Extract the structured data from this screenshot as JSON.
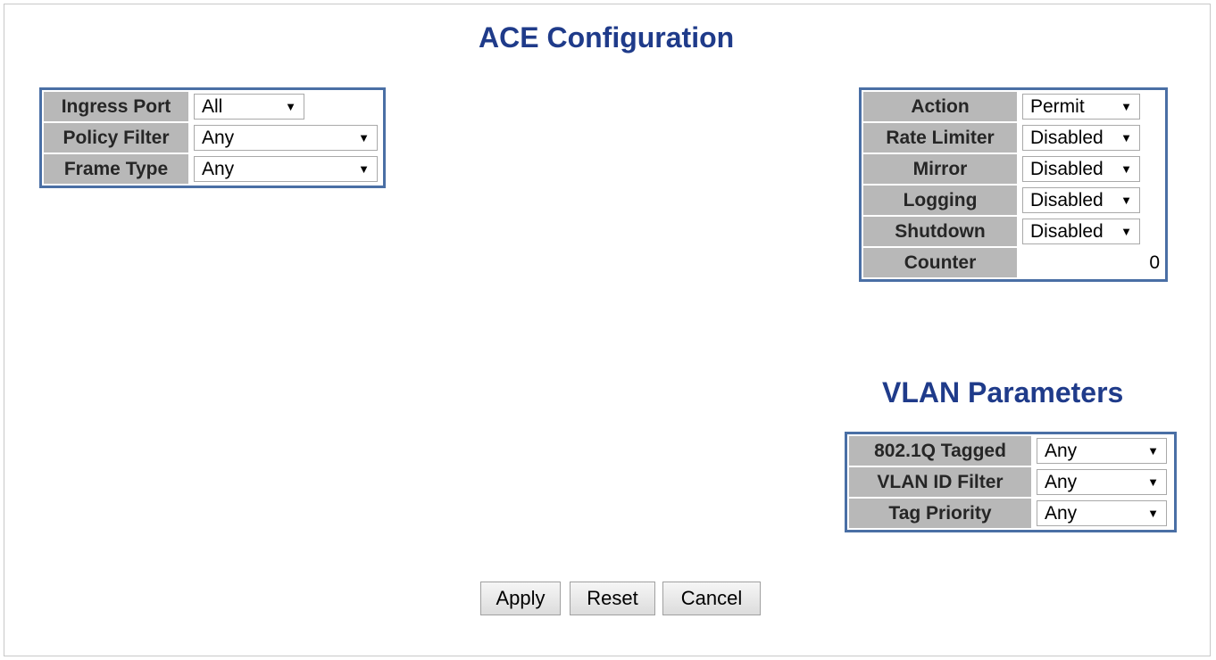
{
  "title": "ACE Configuration",
  "left_table": [
    {
      "label": "Ingress Port",
      "value": "All"
    },
    {
      "label": "Policy Filter",
      "value": "Any"
    },
    {
      "label": "Frame Type",
      "value": "Any"
    }
  ],
  "action_table": [
    {
      "label": "Action",
      "value": "Permit"
    },
    {
      "label": "Rate Limiter",
      "value": "Disabled"
    },
    {
      "label": "Mirror",
      "value": "Disabled"
    },
    {
      "label": "Logging",
      "value": "Disabled"
    },
    {
      "label": "Shutdown",
      "value": "Disabled"
    }
  ],
  "counter": {
    "label": "Counter",
    "value": "0"
  },
  "vlan": {
    "title": "VLAN Parameters",
    "rows": [
      {
        "label": "802.1Q Tagged",
        "value": "Any"
      },
      {
        "label": "VLAN ID Filter",
        "value": "Any"
      },
      {
        "label": "Tag Priority",
        "value": "Any"
      }
    ]
  },
  "buttons": {
    "apply": "Apply",
    "reset": "Reset",
    "cancel": "Cancel"
  },
  "icons": {
    "dropdown": "dropdown-arrow-icon"
  },
  "colors": {
    "title": "#1f3b8a",
    "table_border": "#4a6fa5",
    "label_bg": "#b8b8b8"
  }
}
